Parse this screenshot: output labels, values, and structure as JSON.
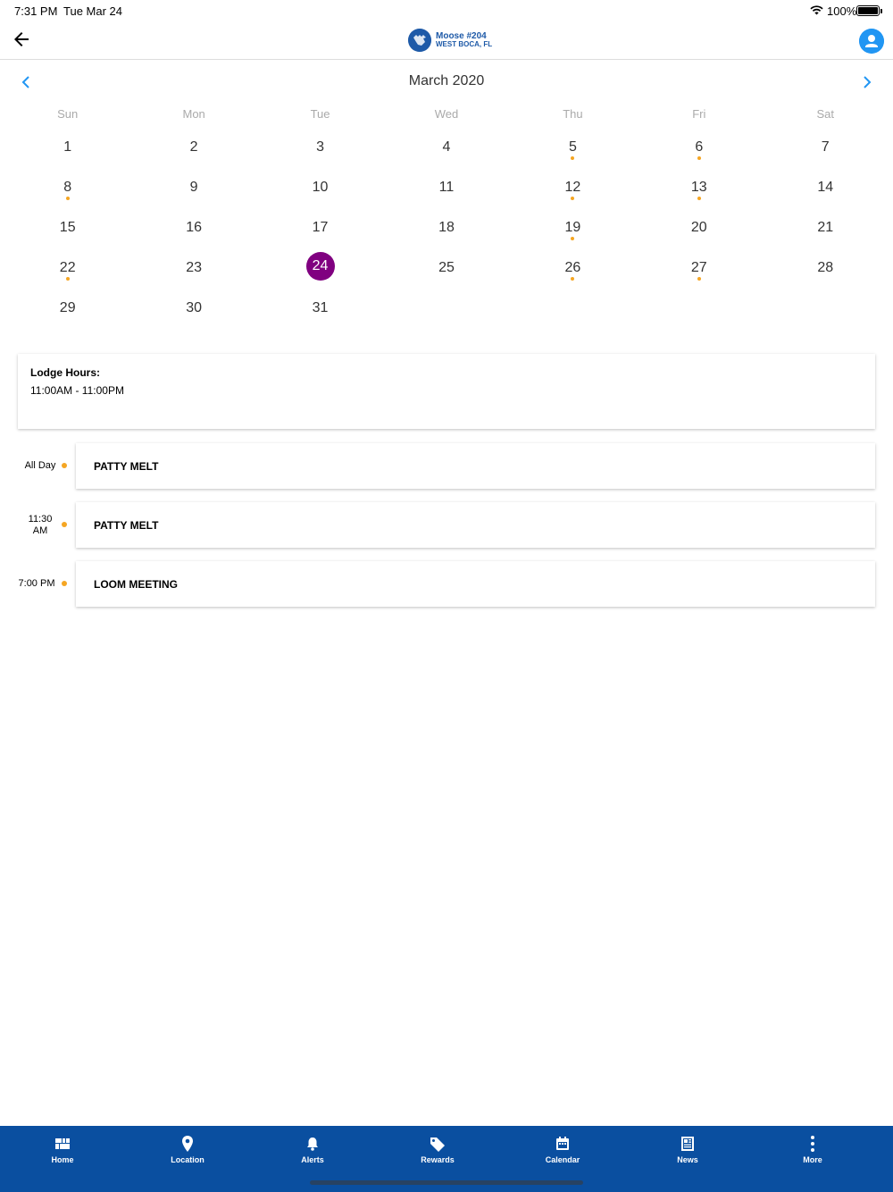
{
  "status_bar": {
    "time": "7:31 PM",
    "date": "Tue Mar 24",
    "battery": "100%"
  },
  "header": {
    "logo_line1": "Moose  #204",
    "logo_line2": "WEST BOCA, FL",
    "back_icon": "arrow-left-icon",
    "profile_icon": "person-icon"
  },
  "calendar": {
    "month_title": "March 2020",
    "weekdays": [
      "Sun",
      "Mon",
      "Tue",
      "Wed",
      "Thu",
      "Fri",
      "Sat"
    ],
    "weeks": [
      [
        "1",
        "2",
        "3",
        "4",
        "5",
        "6",
        "7"
      ],
      [
        "8",
        "9",
        "10",
        "11",
        "12",
        "13",
        "14"
      ],
      [
        "15",
        "16",
        "17",
        "18",
        "19",
        "20",
        "21"
      ],
      [
        "22",
        "23",
        "24",
        "25",
        "26",
        "27",
        "28"
      ],
      [
        "29",
        "30",
        "31",
        "",
        "",
        "",
        ""
      ]
    ],
    "selected_day": "24",
    "days_with_events": [
      "5",
      "6",
      "8",
      "12",
      "13",
      "19",
      "22",
      "26",
      "27"
    ],
    "selected_color": "#800080",
    "event_dot_color": "#f5a623"
  },
  "lodge_hours": {
    "label": "Lodge Hours:",
    "value": "11:00AM - 11:00PM"
  },
  "events": [
    {
      "time_line1": "All Day",
      "time_line2": "",
      "title": "PATTY MELT"
    },
    {
      "time_line1": "11:30",
      "time_line2": "AM",
      "title": "PATTY MELT"
    },
    {
      "time_line1": "7:00 PM",
      "time_line2": "",
      "title": "LOOM MEETING"
    }
  ],
  "tab_bar": {
    "background_color": "#0a4fa0",
    "tabs": [
      {
        "label": "Home",
        "icon": "home-grid-icon"
      },
      {
        "label": "Location",
        "icon": "location-pin-icon"
      },
      {
        "label": "Alerts",
        "icon": "bell-icon"
      },
      {
        "label": "Rewards",
        "icon": "tag-icon"
      },
      {
        "label": "Calendar",
        "icon": "calendar-icon"
      },
      {
        "label": "News",
        "icon": "newspaper-icon"
      },
      {
        "label": "More",
        "icon": "more-vertical-icon"
      }
    ]
  }
}
